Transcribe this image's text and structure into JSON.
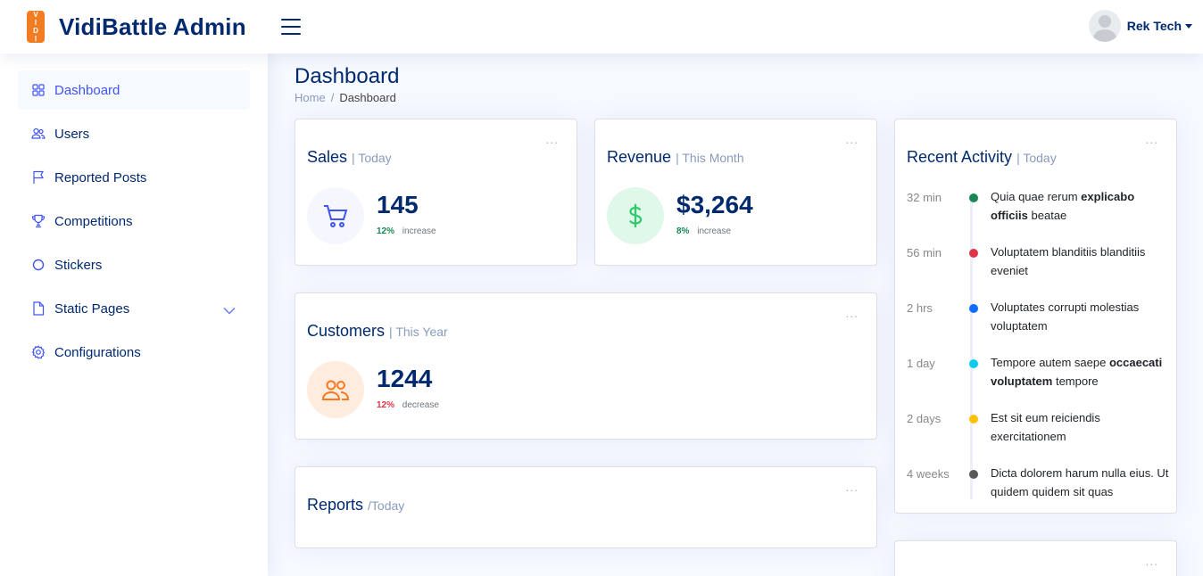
{
  "header": {
    "logo_letters": [
      "V",
      "I",
      "D",
      "I"
    ],
    "app_title": "VidiBattle Admin",
    "user_name": "Rek Tech"
  },
  "sidebar": {
    "items": [
      {
        "label": "Dashboard",
        "icon": "grid-icon",
        "active": true
      },
      {
        "label": "Users",
        "icon": "people-icon"
      },
      {
        "label": "Reported Posts",
        "icon": "flag-icon"
      },
      {
        "label": "Competitions",
        "icon": "trophy-icon"
      },
      {
        "label": "Stickers",
        "icon": "circle-icon"
      },
      {
        "label": "Static Pages",
        "icon": "file-icon",
        "has_dropdown": true
      },
      {
        "label": "Configurations",
        "icon": "gear-icon"
      }
    ]
  },
  "page": {
    "title": "Dashboard",
    "breadcrumb": {
      "home": "Home",
      "separator": "/",
      "current": "Dashboard"
    }
  },
  "cards": {
    "sales": {
      "title": "Sales",
      "subtitle": "| Today",
      "value": "145",
      "pct": "12%",
      "trend": "increase",
      "trend_color": "#198754",
      "icon": "cart-icon",
      "dots": "..."
    },
    "revenue": {
      "title": "Revenue",
      "subtitle": "| This Month",
      "value": "$3,264",
      "pct": "8%",
      "trend": "increase",
      "trend_color": "#198754",
      "icon": "dollar-icon",
      "dots": "..."
    },
    "customers": {
      "title": "Customers",
      "subtitle": "| This Year",
      "value": "1244",
      "pct": "12%",
      "trend": "decrease",
      "trend_color": "#dc3545",
      "icon": "people-icon",
      "dots": "..."
    },
    "reports": {
      "title": "Reports",
      "subtitle": "/Today",
      "dots": "..."
    }
  },
  "activity": {
    "title": "Recent Activity",
    "subtitle": "| Today",
    "dots": "...",
    "items": [
      {
        "time": "32 min",
        "color": "#198754",
        "text_before": "Quia quae rerum ",
        "bold": "explicabo officiis",
        "text_after": " beatae"
      },
      {
        "time": "56 min",
        "color": "#dc3545",
        "text_before": "Voluptatem blanditiis blanditiis eveniet",
        "bold": "",
        "text_after": ""
      },
      {
        "time": "2 hrs",
        "color": "#0d6efd",
        "text_before": "Voluptates corrupti molestias voluptatem",
        "bold": "",
        "text_after": ""
      },
      {
        "time": "1 day",
        "color": "#0dcaf0",
        "text_before": "Tempore autem saepe ",
        "bold": "occaecati voluptatem",
        "text_after": " tempore"
      },
      {
        "time": "2 days",
        "color": "#ffc107",
        "text_before": "Est sit eum reiciendis exercitationem",
        "bold": "",
        "text_after": ""
      },
      {
        "time": "4 weeks",
        "color": "#595959",
        "text_before": "Dicta dolorem harum nulla eius. Ut quidem quidem sit quas",
        "bold": "",
        "text_after": ""
      }
    ]
  },
  "second_right_card": {
    "dots": "..."
  }
}
